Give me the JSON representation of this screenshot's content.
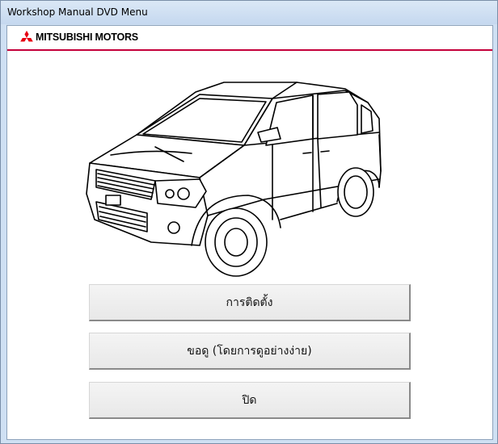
{
  "window": {
    "title": "Workshop Manual DVD Menu"
  },
  "brand": {
    "name": "MITSUBISHI MOTORS",
    "logo_icon": "mitsubishi-diamond-logo",
    "accent_color": "#c4003b"
  },
  "illustration": {
    "icon": "minivan-line-drawing-icon"
  },
  "menu": {
    "install_label": "การติดตั้ง",
    "view_label": "ขอดู (โดยการดูอย่างง่าย)",
    "close_label": "ปิด"
  }
}
